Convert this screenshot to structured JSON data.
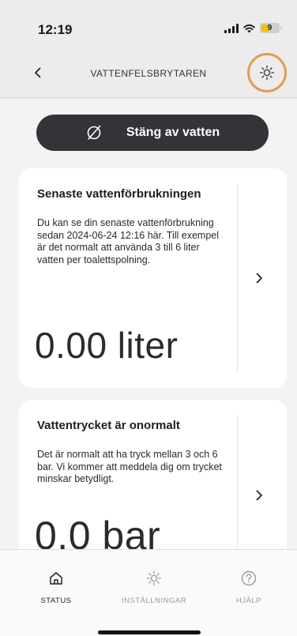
{
  "status_bar": {
    "time": "12:19",
    "battery": "9"
  },
  "header": {
    "title": "VATTENFELSBRYTAREN"
  },
  "icons": {
    "back": "chevron-left-icon",
    "settings": "sun-gear-icon",
    "valve_off": "circle-slash-icon",
    "chevron": "chevron-right-icon",
    "home": "home-icon",
    "help": "question-circle-icon"
  },
  "colors": {
    "accent_ring": "#e59a4f",
    "primary_button": "#333437",
    "battery": "#f0c000"
  },
  "main": {
    "primary_button_label": "Stäng av vatten",
    "cards": [
      {
        "title": "Senaste vattenförbrukningen",
        "description": "Du kan se din senaste vattenförbrukning sedan 2024-06-24 12:16 här. Till exempel är det normalt att använda 3 till 6 liter vatten per toalettspolning.",
        "value": "0.00 liter"
      },
      {
        "title": "Vattentrycket är onormalt",
        "description": "Det är normalt att ha tryck mellan 3 och 6 bar. Vi kommer att meddela dig om trycket minskar betydligt.",
        "value": "0.0 bar"
      }
    ]
  },
  "tabbar": {
    "tabs": [
      {
        "label": "STATUS"
      },
      {
        "label": "INSTÄLLNINGAR"
      },
      {
        "label": "HJÄLP"
      }
    ]
  }
}
